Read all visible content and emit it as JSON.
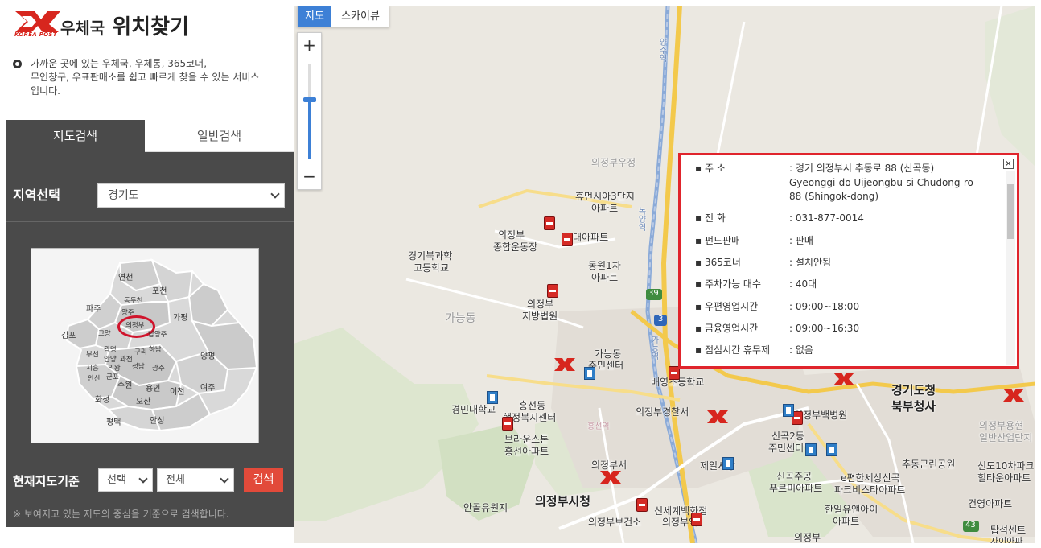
{
  "header": {
    "logo_text": "KOREA POST",
    "title_main": "우체국",
    "title_sub": "위치찾기"
  },
  "intro": {
    "line1": "가까운 곳에 있는 우체국, 우체통, 365코너,",
    "line2": "무인창구, 우표판매소를 쉽고 빠르게 찾을 수 있는 서비스",
    "line3": "입니다."
  },
  "tabs": [
    "지도검색",
    "일반검색"
  ],
  "region": {
    "label": "지역선택",
    "value": "경기도"
  },
  "minimap_labels": [
    "연천",
    "포천",
    "동두천",
    "파주",
    "양주",
    "가평",
    "의정부",
    "김포",
    "고양",
    "남양주",
    "부천",
    "광명",
    "구리",
    "하남",
    "양평",
    "안양",
    "과천",
    "시흥",
    "의왕",
    "성남",
    "광주",
    "군포",
    "안산",
    "수원",
    "용인",
    "이천",
    "여주",
    "화성",
    "오산",
    "평택",
    "안성"
  ],
  "base_search": {
    "label": "현재지도기준",
    "select1": "선택",
    "select2": "전체",
    "button": "검색",
    "note": "※ 보여지고 있는 지도의 중심을 기준으로 검색합니다."
  },
  "map": {
    "type_map": "지도",
    "type_sky": "스카이뷰",
    "zoom_in": "+",
    "zoom_out": "−",
    "zoom_level_fraction": 0.62,
    "labels": {
      "uijeongbu_station_wu": "의정부우정",
      "humansia3": "휴먼시아3단지",
      "apt1": "아파트",
      "uijeongbu1": "의정부",
      "sports": "종합운동장",
      "daeapt": "대아파트",
      "gyeonggi_sci1": "경기북과학",
      "gyeonggi_sci2": "고등학교",
      "dongwon1": "동원1차",
      "apt2": "아파트",
      "uijeongbu2": "의정부",
      "court": "지방법원",
      "ganeung": "가능동",
      "ganeung_center1": "가능동",
      "ganeung_center2": "주민센터",
      "baeyeong": "배영초등학교",
      "heungseon1": "흥선동",
      "heungseon2": "행정복지센터",
      "gyeongmin": "경민대학교",
      "police": "의정부경찰서",
      "brown1": "브라운스톤",
      "brown2": "흥선아파트",
      "uijeongbuseo": "의정부서",
      "singok2_1": "신곡2동",
      "singok2_2": "주민센터",
      "jeil": "제일시장",
      "singokju1": "신곡주공",
      "singokju2": "푸르미아파트",
      "epyeonhan1": "e편한세상신곡",
      "epyeonhan2": "파크비스타아파트",
      "angol": "안골유원지",
      "cityhall": "의정부시청",
      "health": "의정부보건소",
      "singye": "신세계백화점",
      "uijeongbu_station": "의정부역",
      "hanil1": "한일유앤아이",
      "hanil2": "아파트",
      "uijeongbu3": "의정부",
      "hospital": "의정부백병원",
      "gyeonggido1": "경기도청",
      "gyeonggido2": "북부청사",
      "chudong": "추동근린공원",
      "sindo": "신도10차파크",
      "hilltown": "힐타운아파트",
      "geonyeong": "건영아파트",
      "tapseok": "탑석센트",
      "ijiapt": "자이아파",
      "yongheon1": "의정부용현",
      "yongheon2": "일반산업단지",
      "route39": "39",
      "route3": "3",
      "route43": "43",
      "yangju": "양주역",
      "noksa": "녹양역",
      "gane": "가능역",
      "heungseonyeok": "흥선역"
    }
  },
  "popup": {
    "close": "×",
    "rows": [
      {
        "key": "▪ 주 소",
        "value": ": 경기 의정부시 추동로 88 (신곡동)"
      },
      {
        "key": "",
        "value": "Gyeonggi-do Uijeongbu-si Chudong-ro"
      },
      {
        "key": "",
        "value": "88 (Shingok-dong)"
      },
      {
        "key": "▪ 전 화",
        "value": ": 031-877-0014"
      },
      {
        "key": "▪ 펀드판매",
        "value": ": 판매"
      },
      {
        "key": "▪ 365코너",
        "value": ": 설치안됨"
      },
      {
        "key": "▪ 주차가능 대수",
        "value": ": 40대"
      },
      {
        "key": "▪ 우편영업시간",
        "value": ": 09:00~18:00"
      },
      {
        "key": "▪ 금융영업시간",
        "value": ": 09:00~16:30"
      },
      {
        "key": "▪ 점심시간 휴무제",
        "value": ": 없음"
      }
    ]
  },
  "colors": {
    "accent_blue": "#3d80d6",
    "brand_red": "#d7261e",
    "panel_dark": "#4a4a4a",
    "search_red": "#e24a3a",
    "popup_border": "#e0242c"
  }
}
